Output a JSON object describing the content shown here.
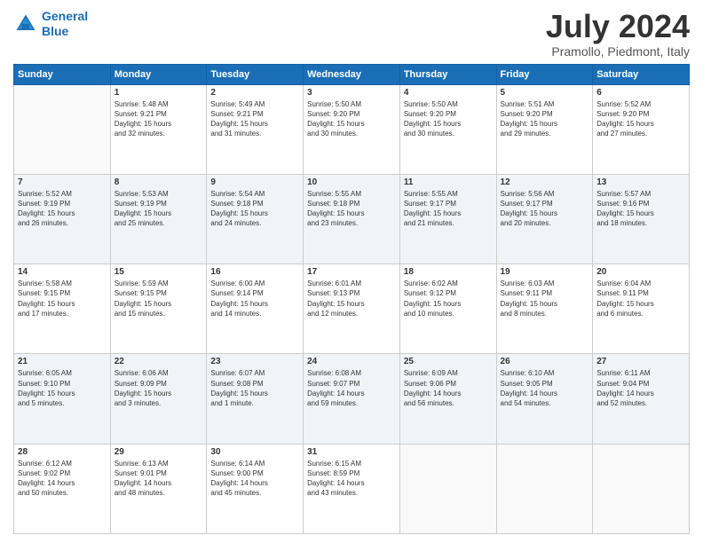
{
  "header": {
    "logo_line1": "General",
    "logo_line2": "Blue",
    "month": "July 2024",
    "location": "Pramollo, Piedmont, Italy"
  },
  "days_of_week": [
    "Sunday",
    "Monday",
    "Tuesday",
    "Wednesday",
    "Thursday",
    "Friday",
    "Saturday"
  ],
  "weeks": [
    [
      {
        "num": "",
        "info": ""
      },
      {
        "num": "1",
        "info": "Sunrise: 5:48 AM\nSunset: 9:21 PM\nDaylight: 15 hours\nand 32 minutes."
      },
      {
        "num": "2",
        "info": "Sunrise: 5:49 AM\nSunset: 9:21 PM\nDaylight: 15 hours\nand 31 minutes."
      },
      {
        "num": "3",
        "info": "Sunrise: 5:50 AM\nSunset: 9:20 PM\nDaylight: 15 hours\nand 30 minutes."
      },
      {
        "num": "4",
        "info": "Sunrise: 5:50 AM\nSunset: 9:20 PM\nDaylight: 15 hours\nand 30 minutes."
      },
      {
        "num": "5",
        "info": "Sunrise: 5:51 AM\nSunset: 9:20 PM\nDaylight: 15 hours\nand 29 minutes."
      },
      {
        "num": "6",
        "info": "Sunrise: 5:52 AM\nSunset: 9:20 PM\nDaylight: 15 hours\nand 27 minutes."
      }
    ],
    [
      {
        "num": "7",
        "info": "Sunrise: 5:52 AM\nSunset: 9:19 PM\nDaylight: 15 hours\nand 26 minutes."
      },
      {
        "num": "8",
        "info": "Sunrise: 5:53 AM\nSunset: 9:19 PM\nDaylight: 15 hours\nand 25 minutes."
      },
      {
        "num": "9",
        "info": "Sunrise: 5:54 AM\nSunset: 9:18 PM\nDaylight: 15 hours\nand 24 minutes."
      },
      {
        "num": "10",
        "info": "Sunrise: 5:55 AM\nSunset: 9:18 PM\nDaylight: 15 hours\nand 23 minutes."
      },
      {
        "num": "11",
        "info": "Sunrise: 5:55 AM\nSunset: 9:17 PM\nDaylight: 15 hours\nand 21 minutes."
      },
      {
        "num": "12",
        "info": "Sunrise: 5:56 AM\nSunset: 9:17 PM\nDaylight: 15 hours\nand 20 minutes."
      },
      {
        "num": "13",
        "info": "Sunrise: 5:57 AM\nSunset: 9:16 PM\nDaylight: 15 hours\nand 18 minutes."
      }
    ],
    [
      {
        "num": "14",
        "info": "Sunrise: 5:58 AM\nSunset: 9:15 PM\nDaylight: 15 hours\nand 17 minutes."
      },
      {
        "num": "15",
        "info": "Sunrise: 5:59 AM\nSunset: 9:15 PM\nDaylight: 15 hours\nand 15 minutes."
      },
      {
        "num": "16",
        "info": "Sunrise: 6:00 AM\nSunset: 9:14 PM\nDaylight: 15 hours\nand 14 minutes."
      },
      {
        "num": "17",
        "info": "Sunrise: 6:01 AM\nSunset: 9:13 PM\nDaylight: 15 hours\nand 12 minutes."
      },
      {
        "num": "18",
        "info": "Sunrise: 6:02 AM\nSunset: 9:12 PM\nDaylight: 15 hours\nand 10 minutes."
      },
      {
        "num": "19",
        "info": "Sunrise: 6:03 AM\nSunset: 9:11 PM\nDaylight: 15 hours\nand 8 minutes."
      },
      {
        "num": "20",
        "info": "Sunrise: 6:04 AM\nSunset: 9:11 PM\nDaylight: 15 hours\nand 6 minutes."
      }
    ],
    [
      {
        "num": "21",
        "info": "Sunrise: 6:05 AM\nSunset: 9:10 PM\nDaylight: 15 hours\nand 5 minutes."
      },
      {
        "num": "22",
        "info": "Sunrise: 6:06 AM\nSunset: 9:09 PM\nDaylight: 15 hours\nand 3 minutes."
      },
      {
        "num": "23",
        "info": "Sunrise: 6:07 AM\nSunset: 9:08 PM\nDaylight: 15 hours\nand 1 minute."
      },
      {
        "num": "24",
        "info": "Sunrise: 6:08 AM\nSunset: 9:07 PM\nDaylight: 14 hours\nand 59 minutes."
      },
      {
        "num": "25",
        "info": "Sunrise: 6:09 AM\nSunset: 9:06 PM\nDaylight: 14 hours\nand 56 minutes."
      },
      {
        "num": "26",
        "info": "Sunrise: 6:10 AM\nSunset: 9:05 PM\nDaylight: 14 hours\nand 54 minutes."
      },
      {
        "num": "27",
        "info": "Sunrise: 6:11 AM\nSunset: 9:04 PM\nDaylight: 14 hours\nand 52 minutes."
      }
    ],
    [
      {
        "num": "28",
        "info": "Sunrise: 6:12 AM\nSunset: 9:02 PM\nDaylight: 14 hours\nand 50 minutes."
      },
      {
        "num": "29",
        "info": "Sunrise: 6:13 AM\nSunset: 9:01 PM\nDaylight: 14 hours\nand 48 minutes."
      },
      {
        "num": "30",
        "info": "Sunrise: 6:14 AM\nSunset: 9:00 PM\nDaylight: 14 hours\nand 45 minutes."
      },
      {
        "num": "31",
        "info": "Sunrise: 6:15 AM\nSunset: 8:59 PM\nDaylight: 14 hours\nand 43 minutes."
      },
      {
        "num": "",
        "info": ""
      },
      {
        "num": "",
        "info": ""
      },
      {
        "num": "",
        "info": ""
      }
    ]
  ]
}
